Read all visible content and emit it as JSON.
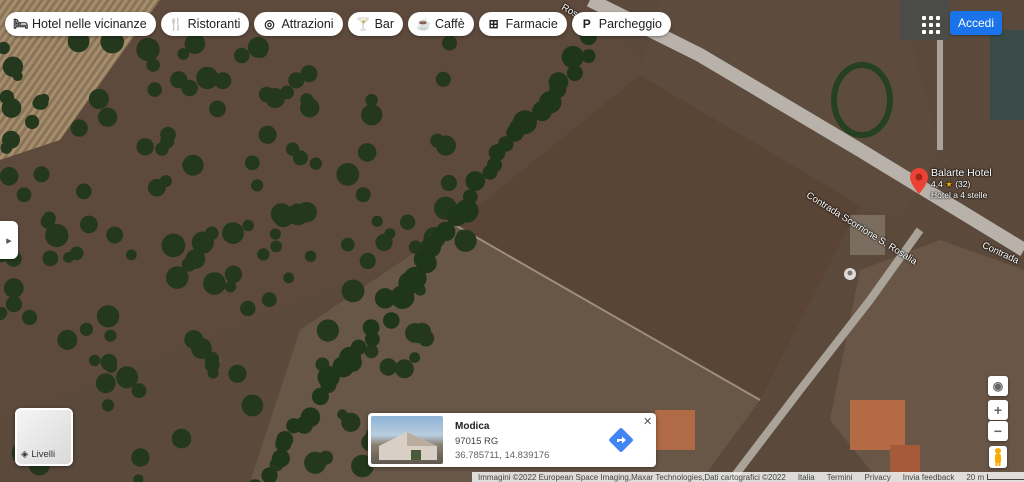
{
  "categories": [
    {
      "icon": "bed-icon",
      "glyph": "🛏",
      "label": "Hotel nelle vicinanze"
    },
    {
      "icon": "fork-knife-icon",
      "glyph": "🍴",
      "label": "Ristoranti"
    },
    {
      "icon": "camera-icon",
      "glyph": "◎",
      "label": "Attrazioni"
    },
    {
      "icon": "cocktail-icon",
      "glyph": "🍸",
      "label": "Bar"
    },
    {
      "icon": "coffee-cup-icon",
      "glyph": "☕",
      "label": "Caffè"
    },
    {
      "icon": "pharmacy-icon",
      "glyph": "⊞",
      "label": "Farmacie"
    },
    {
      "icon": "parking-icon",
      "glyph": "P",
      "label": "Parcheggio"
    }
  ],
  "header": {
    "signin_label": "Accedi"
  },
  "map": {
    "road_label_1": "Contrada Scorrione S. Rosalia",
    "road_label_2": "Contrada",
    "road_label_top": "Rosalia",
    "place": {
      "name": "Balarte Hotel",
      "rating": "4,4",
      "reviews": "(32)",
      "category": "Hotel a 4 stelle"
    },
    "pin_color": "#ea4335"
  },
  "layers": {
    "label": "Livelli"
  },
  "info_card": {
    "title": "Modica",
    "subtitle": "97015 RG",
    "coords": "36.785711, 14.839176",
    "accent": "#4285f4"
  },
  "footer": {
    "imagery": "Immagini ©2022 European Space Imaging,Maxar Technologies,Dati cartografici ©2022",
    "links": [
      "Italia",
      "Termini",
      "Privacy",
      "Invia feedback"
    ],
    "scale": "20 m"
  }
}
